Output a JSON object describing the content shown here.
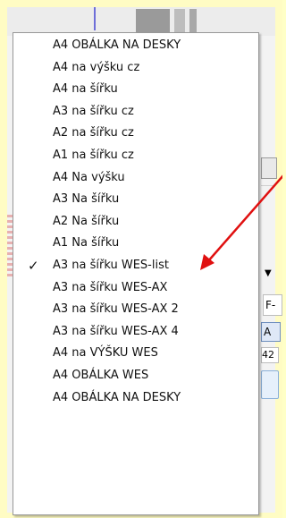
{
  "menu": {
    "items": [
      {
        "label": "A4  OBÁLKA NA DESKY",
        "checked": false
      },
      {
        "label": "A4 na výšku cz",
        "checked": false
      },
      {
        "label": "A4 na šířku",
        "checked": false
      },
      {
        "label": "A3 na šířku cz",
        "checked": false
      },
      {
        "label": "A2 na šířku cz",
        "checked": false
      },
      {
        "label": "A1 na šířku cz",
        "checked": false
      },
      {
        "label": "A4 Na výšku",
        "checked": false
      },
      {
        "label": "A3 Na šířku",
        "checked": false
      },
      {
        "label": "A2 Na šířku",
        "checked": false
      },
      {
        "label": "A1 Na šířku",
        "checked": false
      },
      {
        "label": "A3 na šířku WES-list",
        "checked": true
      },
      {
        "label": "A3 na šířku WES-AX",
        "checked": false
      },
      {
        "label": "A3 na šířku WES-AX 2",
        "checked": false
      },
      {
        "label": "A3 na šířku WES-AX 4",
        "checked": false
      },
      {
        "label": "A4 na VÝŠKU WES",
        "checked": false
      },
      {
        "label": "A4  OBÁLKA WES",
        "checked": false
      },
      {
        "label": "A4  OBÁLKA NA DESKY",
        "checked": false
      }
    ],
    "check_glyph": "✓"
  },
  "background": {
    "field_text": "F-",
    "button_text": "A",
    "number_text": "42"
  },
  "colors": {
    "frame": "#fffcc4",
    "arrow": "#e01010",
    "menu_bg": "#ffffff"
  }
}
